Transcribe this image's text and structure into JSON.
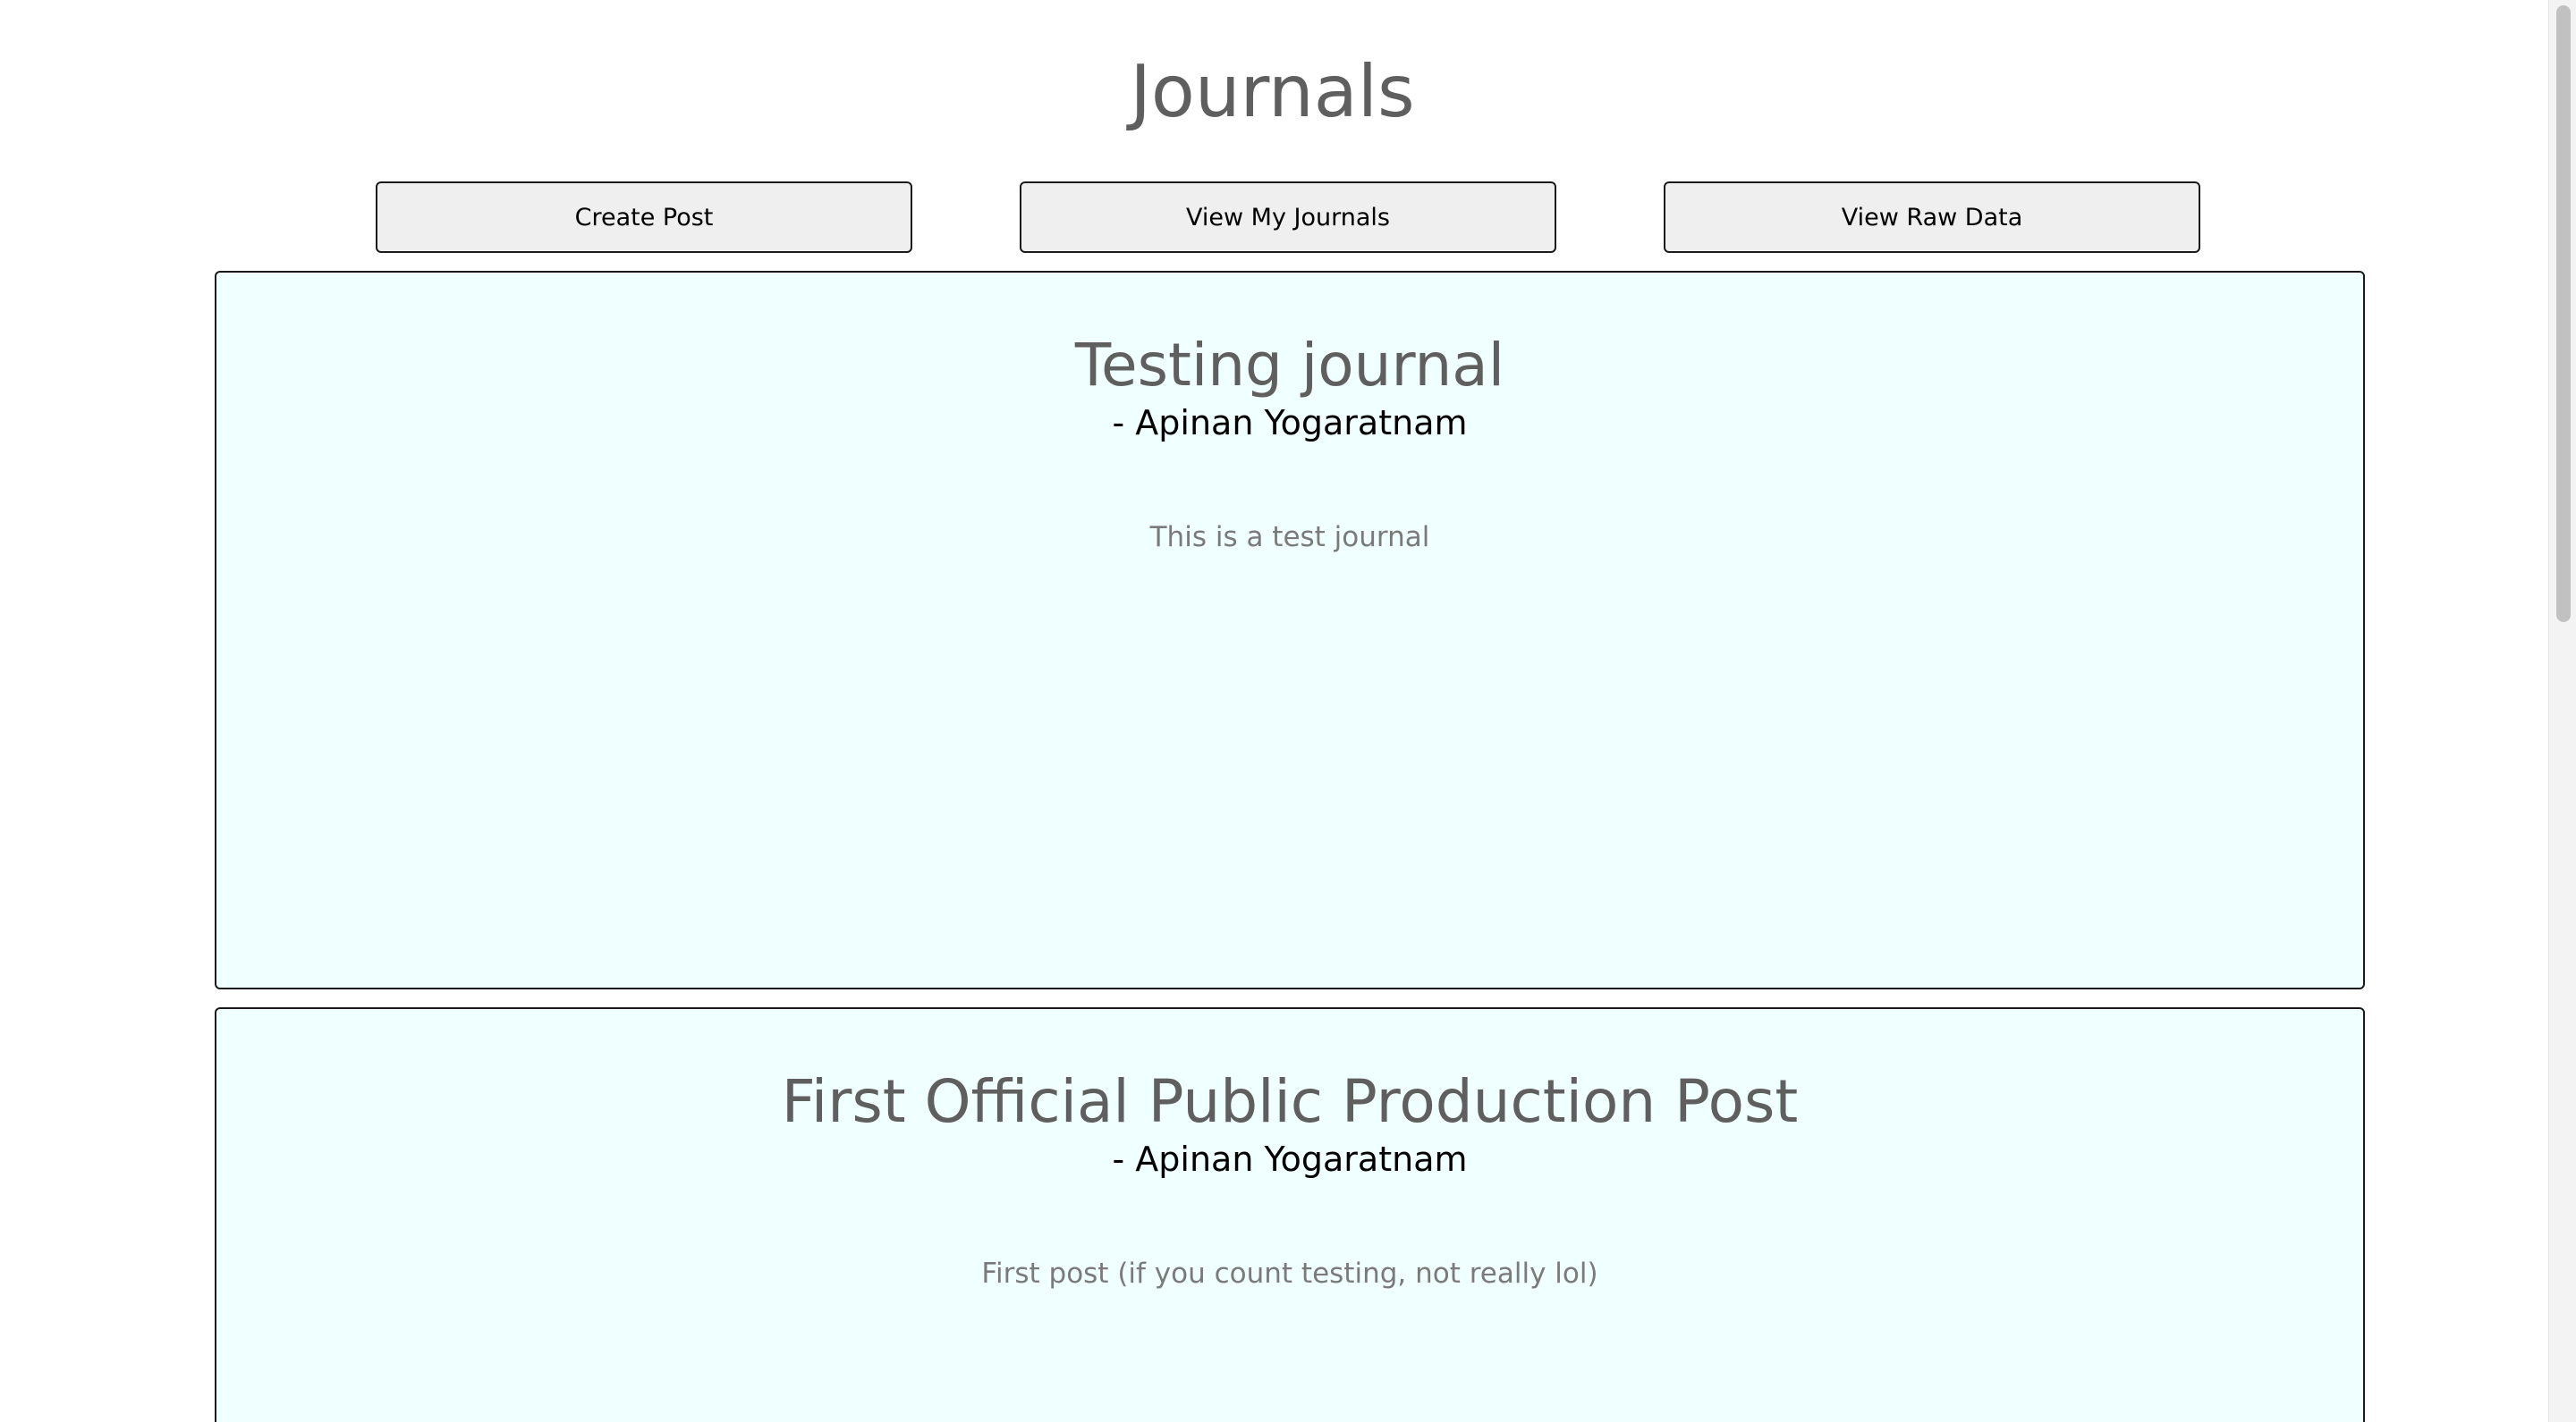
{
  "page": {
    "title": "Journals"
  },
  "toolbar": {
    "create_post_label": "Create Post",
    "view_my_journals_label": "View My Journals",
    "view_raw_data_label": "View Raw Data"
  },
  "journals": [
    {
      "title": "Testing journal",
      "author": "- Apinan Yogaratnam",
      "body": "This is a test journal"
    },
    {
      "title": "First Official Public Production Post",
      "author": "- Apinan Yogaratnam",
      "body": "First post (if you count testing, not really lol)"
    }
  ],
  "colors": {
    "card_background": "#f0ffff",
    "button_background": "#efefef",
    "title_text": "#5f5f5f",
    "body_text": "#7a7a7a"
  }
}
